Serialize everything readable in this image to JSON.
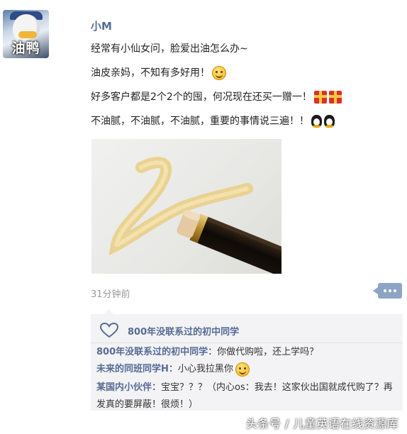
{
  "author": {
    "avatar_text": "油鸭",
    "name": "小M"
  },
  "post": {
    "lines": [
      "经常有小仙女问，脸爱出油怎么办~",
      "油皮亲妈，不知有多好用！",
      "好多客户都是2个2个的囤，何况现在还买一赠一！",
      "不油腻，不油腻，不油腻，重要的事情说三遍！！"
    ],
    "emojis": [
      "smile-emoji",
      "gift-emoji",
      "penguin-emoji"
    ],
    "time": "31分钟前"
  },
  "interactions": {
    "likes": "800年没联系过的初中同学",
    "comments": [
      {
        "name": "800年没联系过的初中同学",
        "text": "：你做代购啦，还上学吗？"
      },
      {
        "name": "未来的同班同学H",
        "text": "：小心我拉黑你"
      },
      {
        "name": "某国内小伙伴",
        "text": "：宝宝？？？（内心os：我去！这家伙出国就成代购了？再发真的要屏蔽！很烦！）"
      }
    ]
  },
  "watermark": "头条号 / 儿童英语在线资源库",
  "colors": {
    "name_blue": "#576b95",
    "panel_bg": "#f3f3f5",
    "more_button": "#8fa4c4"
  }
}
